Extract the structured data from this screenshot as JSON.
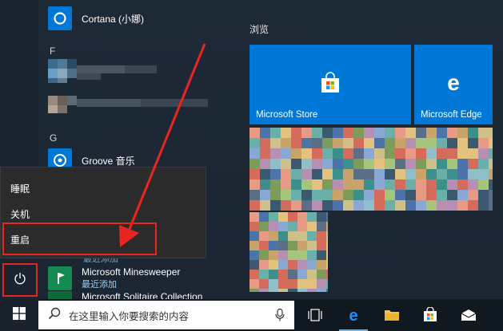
{
  "app_list": {
    "cortana": {
      "name": "Cortana (小娜)"
    },
    "letter_f": "F",
    "letter_g": "G",
    "groove": {
      "name": "Groove 音乐"
    },
    "recently_added_partial": "最近添加",
    "minesweeper": {
      "name": "Microsoft Minesweeper",
      "sub": "最近添加"
    },
    "solitaire_partial": {
      "name": "Microsoft Solitaire Collection"
    }
  },
  "power_menu": {
    "sleep": "睡眠",
    "shutdown": "关机",
    "restart": "重启"
  },
  "tiles": {
    "group_title": "浏览",
    "store": {
      "label": "Microsoft Store",
      "icon": "store-bag-icon"
    },
    "edge": {
      "label": "Microsoft Edge",
      "icon": "edge-e-icon"
    }
  },
  "taskbar": {
    "search_placeholder": "在这里输入你要搜索的内容",
    "icons": [
      "windows-logo-icon",
      "microphone-icon",
      "task-view-icon",
      "edge-icon",
      "file-explorer-icon",
      "store-icon",
      "mail-icon"
    ]
  },
  "colors": {
    "accent": "#0078d7",
    "annotation_red": "#e8261f",
    "menu_bg": "#1e2936",
    "taskbar_bg": "#101820"
  }
}
